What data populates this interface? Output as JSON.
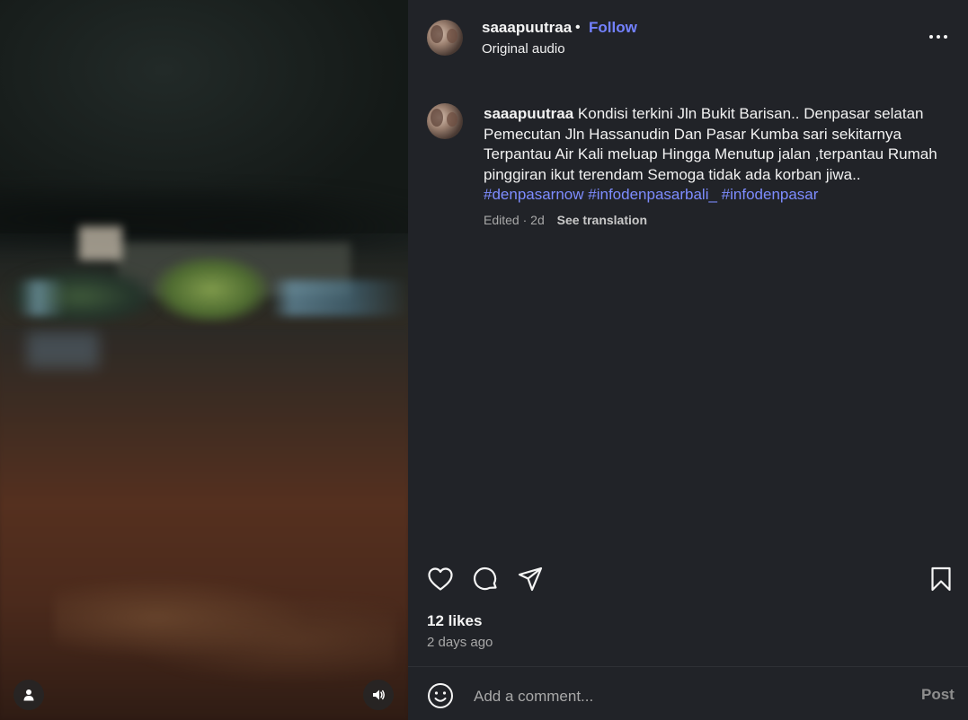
{
  "post": {
    "username": "saaapuutraa",
    "separator": "•",
    "follow_label": "Follow",
    "audio_label": "Original audio"
  },
  "caption": {
    "username": "saaapuutraa",
    "text": "Kondisi terkini Jln Bukit Barisan.. Denpasar selatan Pemecutan Jln Hassanudin Dan Pasar Kumba sari sekitarnya Terpantau Air Kali meluap Hingga Menutup jalan ,terpantau Rumah pinggiran ikut terendam Semoga tidak ada korban jiwa..",
    "hashtags": [
      "#denpasarnow",
      "#infodenpasarbali_",
      "#infodenpasar"
    ],
    "edited_label": "Edited",
    "meta_separator": "·",
    "time": "2d",
    "see_translation_label": "See translation"
  },
  "stats": {
    "likes": "12 likes",
    "posted_ago": "2 days ago"
  },
  "comment": {
    "placeholder": "Add a comment...",
    "post_label": "Post"
  },
  "icons": {
    "more": "more-horizontal-icon",
    "like": "heart-icon",
    "comment": "comment-bubble-icon",
    "share": "paper-plane-icon",
    "save": "bookmark-icon",
    "emoji": "smiley-icon",
    "tagged_users": "user-icon",
    "sound": "speaker-icon"
  },
  "colors": {
    "background": "#212328",
    "accent": "#7381ff",
    "hashtag": "#7d8cff",
    "muted": "#a8a8a8"
  }
}
